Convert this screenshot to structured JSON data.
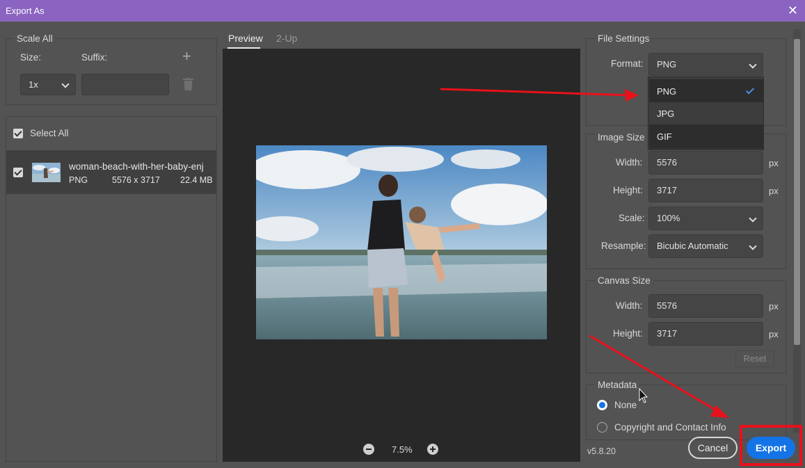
{
  "window": {
    "title": "Export As",
    "close_glyph": "✕"
  },
  "left": {
    "scale_all": "Scale All",
    "size_label": "Size:",
    "suffix_label": "Suffix:",
    "add_glyph": "+",
    "size_value": "1x",
    "suffix_value": "",
    "select_all": "Select All",
    "file": {
      "name": "woman-beach-with-her-baby-enj",
      "format": "PNG",
      "dimensions": "5576 x 3717",
      "size": "22.4 MB"
    }
  },
  "tabs": [
    {
      "label": "Preview",
      "active": true
    },
    {
      "label": "2-Up",
      "active": false
    }
  ],
  "zoom": {
    "value": "7.5%",
    "minus_glyph": "−",
    "plus_glyph": "+"
  },
  "file_settings": {
    "title": "File Settings",
    "format_label": "Format:",
    "format_value": "PNG",
    "options": [
      "PNG",
      "JPG",
      "GIF"
    ],
    "selected_index": 0
  },
  "image_size": {
    "title": "Image Size",
    "width_label": "Width:",
    "width_value": "5576",
    "height_label": "Height:",
    "height_value": "3717",
    "scale_label": "Scale:",
    "scale_value": "100%",
    "resample_label": "Resample:",
    "resample_value": "Bicubic Automatic",
    "unit": "px"
  },
  "canvas_size": {
    "title": "Canvas Size",
    "width_label": "Width:",
    "width_value": "5576",
    "height_label": "Height:",
    "height_value": "3717",
    "unit": "px",
    "reset_label": "Reset"
  },
  "metadata": {
    "title": "Metadata",
    "options": [
      "None",
      "Copyright and Contact Info"
    ],
    "selected": "None"
  },
  "footer": {
    "version": "v5.8.20",
    "cancel_label": "Cancel",
    "export_label": "Export"
  },
  "colors": {
    "titlebar": "#8a64c0",
    "accent": "#1473e6",
    "annotation": "#e8101a"
  }
}
